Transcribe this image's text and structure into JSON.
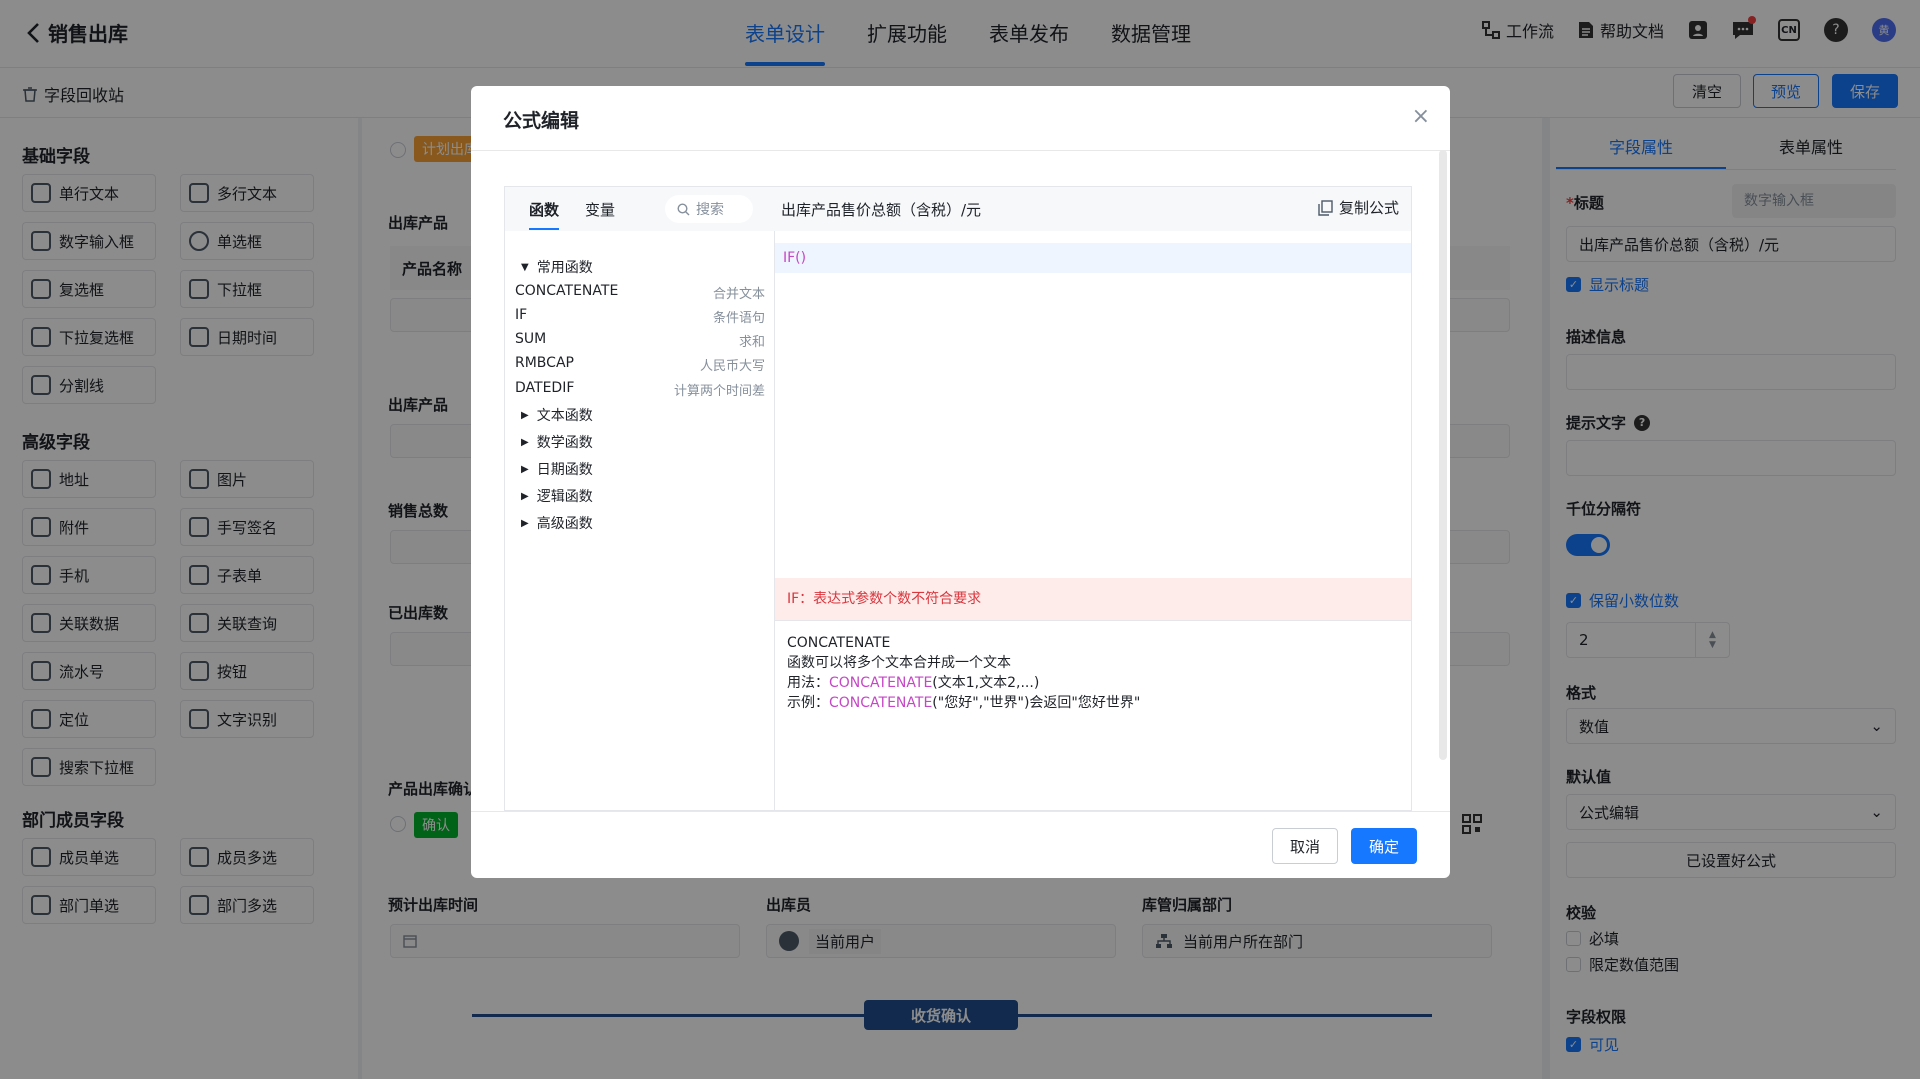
{
  "topnav": {
    "title": "销售出库",
    "tabs": [
      "表单设计",
      "扩展功能",
      "表单发布",
      "数据管理"
    ],
    "right": {
      "workflow": "工作流",
      "help_doc": "帮助文档",
      "help_circle": "?",
      "lang": "CN",
      "avatar": "黄"
    }
  },
  "subbar": {
    "recycle": "字段回收站",
    "clear": "清空",
    "preview": "预览",
    "save": "保存"
  },
  "left": {
    "basic_title": "基础字段",
    "basic": [
      "单行文本",
      "多行文本",
      "数字输入框",
      "单选框",
      "复选框",
      "下拉框",
      "下拉复选框",
      "日期时间",
      "分割线"
    ],
    "advanced_title": "高级字段",
    "advanced": [
      "地址",
      "图片",
      "附件",
      "手写签名",
      "手机",
      "子表单",
      "关联数据",
      "关联查询",
      "流水号",
      "按钮",
      "定位",
      "文字识别",
      "搜索下拉框"
    ],
    "member_title": "部门成员字段",
    "member": [
      "成员单选",
      "成员多选",
      "部门单选",
      "部门多选"
    ]
  },
  "canvas": {
    "tag_plan": "计划出库",
    "section1": "出库产品",
    "col_product": "产品名称",
    "section2": "出库产品",
    "section3": "销售总数",
    "section4": "已出库数",
    "section5": "产品出库确认",
    "confirm_tag": "确认",
    "est_time_label": "预计出库时间",
    "operator_label": "出库员",
    "operator_value": "当前用户",
    "dept_label": "库管归属部门",
    "dept_value": "当前用户所在部门",
    "divider": "收货确认"
  },
  "right": {
    "tab_field": "字段属性",
    "tab_form": "表单属性",
    "title_label": "标题",
    "title_type": "数字输入框",
    "title_value": "出库产品售价总额（含税）/元",
    "show_title": "显示标题",
    "desc_label": "描述信息",
    "hint_label": "提示文字",
    "thousand_label": "千位分隔符",
    "thousand_on": true,
    "decimal_label": "保留小数位数",
    "decimal_value": "2",
    "format_label": "格式",
    "format_value": "数值",
    "default_label": "默认值",
    "default_value": "公式编辑",
    "formula_set": "已设置好公式",
    "check_label": "校验",
    "required": "必填",
    "range": "限定数值范围",
    "perm_label": "字段权限",
    "visible": "可见"
  },
  "modal": {
    "title": "公式编辑",
    "tab_fn": "函数",
    "tab_var": "变量",
    "search_placeholder": "搜索",
    "common_title": "常用函数",
    "common": [
      {
        "name": "CONCATENATE",
        "desc": "合并文本"
      },
      {
        "name": "IF",
        "desc": "条件语句"
      },
      {
        "name": "SUM",
        "desc": "求和"
      },
      {
        "name": "RMBCAP",
        "desc": "人民币大写"
      },
      {
        "name": "DATEDIF",
        "desc": "计算两个时间差"
      }
    ],
    "categories": [
      "文本函数",
      "数学函数",
      "日期函数",
      "逻辑函数",
      "高级函数"
    ],
    "field_title": "出库产品售价总额（含税）/元",
    "copy": "复制公式",
    "formula": "IF()",
    "error": "IF：表达式参数个数不符合要求",
    "help_name": "CONCATENATE",
    "help_desc": "函数可以将多个文本合并成一个文本",
    "help_usage_pre": "用法：",
    "help_usage_fn": "CONCATENATE",
    "help_usage_args": "(文本1,文本2,...)",
    "help_example_pre": "示例：",
    "help_example_fn": "CONCATENATE",
    "help_example_args": "(\"您好\",\"世界\")会返回\"您好世界\"",
    "cancel": "取消",
    "ok": "确定"
  },
  "colors": {
    "primary": "#1677ff",
    "error_bg": "#fdecea",
    "error_text": "#d9363e",
    "fn_highlight": "#c547c5"
  }
}
